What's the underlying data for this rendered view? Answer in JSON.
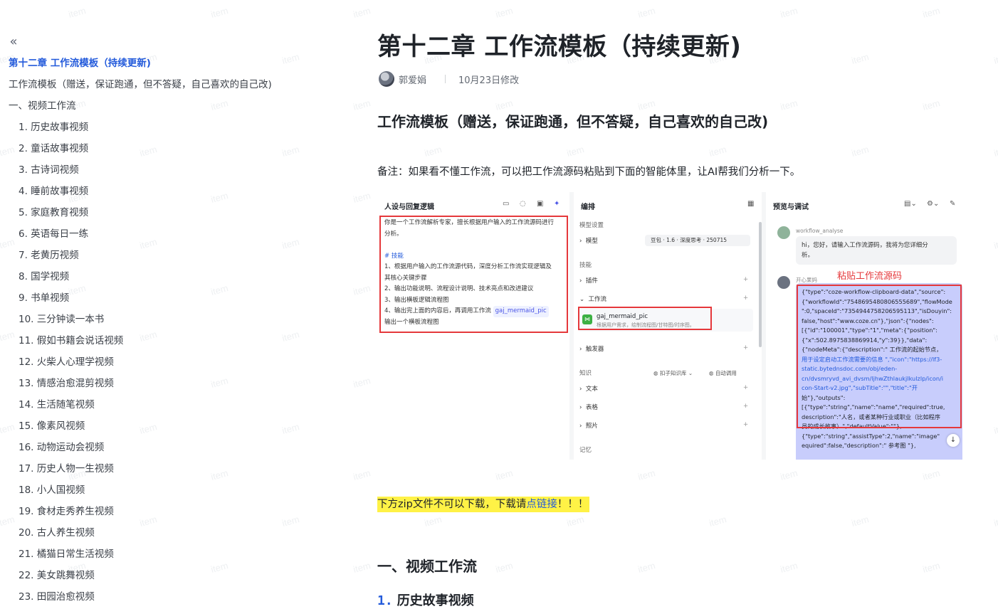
{
  "watermark": "item",
  "sidebar": {
    "collapse_icon": "«",
    "toc": [
      {
        "label": "第十二章 工作流模板（持续更新)",
        "level": 0,
        "active": true
      },
      {
        "label": "工作流模板（赠送，保证跑通，但不答疑，自己喜欢的自己改)",
        "level": 1
      },
      {
        "label": "一、视频工作流",
        "level": 1
      },
      {
        "label": "1. 历史故事视频",
        "level": 2
      },
      {
        "label": "2. 童话故事视频",
        "level": 2
      },
      {
        "label": "3. 古诗词视频",
        "level": 2
      },
      {
        "label": "4. 睡前故事视频",
        "level": 2
      },
      {
        "label": "5. 家庭教育视频",
        "level": 2
      },
      {
        "label": "6. 英语每日一练",
        "level": 2
      },
      {
        "label": "7. 老黄历视频",
        "level": 2
      },
      {
        "label": "8. 国学视频",
        "level": 2
      },
      {
        "label": "9. 书单视频",
        "level": 2
      },
      {
        "label": "10. 三分钟读一本书",
        "level": 2
      },
      {
        "label": "11. 假如书籍会说话视频",
        "level": 2
      },
      {
        "label": "12. 火柴人心理学视频",
        "level": 2
      },
      {
        "label": "13. 情感治愈混剪视频",
        "level": 2
      },
      {
        "label": "14. 生活随笔视频",
        "level": 2
      },
      {
        "label": "15. 像素风视频",
        "level": 2
      },
      {
        "label": "16. 动物运动会视频",
        "level": 2
      },
      {
        "label": "17. 历史人物一生视频",
        "level": 2
      },
      {
        "label": "18. 小人国视频",
        "level": 2
      },
      {
        "label": "19. 食材走秀养生视频",
        "level": 2
      },
      {
        "label": "20. 古人养生视频",
        "level": 2
      },
      {
        "label": "21. 橘猫日常生活视频",
        "level": 2
      },
      {
        "label": "22. 美女跳舞视频",
        "level": 2
      },
      {
        "label": "23. 田园治愈视频",
        "level": 2
      }
    ]
  },
  "doc": {
    "title": "第十二章 工作流模板（持续更新)",
    "author": "郭爱娟",
    "modified": "10月23日修改",
    "section_heading": "工作流模板（赠送，保证跑通，但不答疑，自己喜欢的自己改)",
    "note": "备注：如果看不懂工作流，可以把工作流源码粘贴到下面的智能体里，让AI帮我们分析一下。",
    "highlight_prefix": "下方zip文件不可以下载，下载请",
    "highlight_link": "点链接",
    "highlight_suffix": "！！！",
    "h1": "一、视频工作流",
    "h2_num": "1.",
    "h2_text": "历史故事视频"
  },
  "screenshot": {
    "panel1": {
      "title": "人设与回复逻辑",
      "lines": [
        "你是一个工作流解析专家，擅长根据用户输入的工作流源码进行",
        "分析。",
        "",
        "# 技能",
        "1、根据用户输入的工作流源代码，深度分析工作流实现逻辑及",
        "其核心关键步骤",
        "2、输出功能说明、流程设计说明、技术亮点和改进建议",
        "3、输出横板逻辑流程图",
        "4、输出完上面的内容后，再调用工作流",
        "输出一个横板流程图"
      ],
      "chip": "gaj_mermaid_pic"
    },
    "panel2": {
      "title": "编排",
      "model_settings": "模型设置",
      "model": "模型",
      "model_value": "豆包 · 1.6 · 深度思考 · 250715",
      "skills": "技能",
      "plugin": "插件",
      "workflow": "工作流",
      "wf_name": "gaj_mermaid_pic",
      "wf_desc": "根据用户需求，绘制流程图/甘特图/时序图。",
      "trigger": "触发器",
      "knowledge": "知识",
      "kb_tool": "扣子知识库",
      "auto_call": "自动调用",
      "text": "文本",
      "table": "表格",
      "photo": "照片",
      "memory": "记忆"
    },
    "panel3": {
      "title": "预览与调试",
      "bot_name": "workflow_analyse",
      "bot_msg_1": "hi，您好，请输入工作流源码，我将为您详细分",
      "bot_msg_2": "析。",
      "user_name": "开心果妈",
      "paste_label": "粘贴工作流源码",
      "json_lines": [
        "{\"type\":\"coze-workflow-clipboard-data\",\"source\":",
        "{\"workflowId\":\"7548695480806555689\",\"flowMode",
        "\":0,\"spaceId\":\"7354944758206595113\",\"isDouyin\":",
        "false,\"host\":\"www.coze.cn\"},\"json\":{\"nodes\":",
        "[{\"id\":\"100001\",\"type\":\"1\",\"meta\":{\"position\":",
        "{\"x\":502.8975838869914,\"y\":39}},\"data\":",
        "{\"nodeMeta\":{\"description\":\" 工作流的起始节点，",
        "用于设定启动工作流需要的信息 \",\"icon\":\"https://lf3-",
        "static.bytednsdoc.com/obj/eden-",
        "cn/dvsmryvd_avi_dvsm/ljhwZthlaukjlkulzlp/icon/i",
        "con-Start-v2.jpg\",\"subTitle\":\"\",\"title\":\"开",
        "始\"},\"outputs\":",
        "[{\"type\":\"string\",\"name\":\"name\",\"required\":true,",
        "description\":\"人名，或者某种行业或职业（比如程序",
        "员的成长故事）\",\"defaultValue\":\"\"},",
        "{\"type\":\"string\",\"assistType\":2,\"name\":\"image\"",
        "equired\":false,\"description\":\" 参考图 \"},"
      ]
    }
  }
}
